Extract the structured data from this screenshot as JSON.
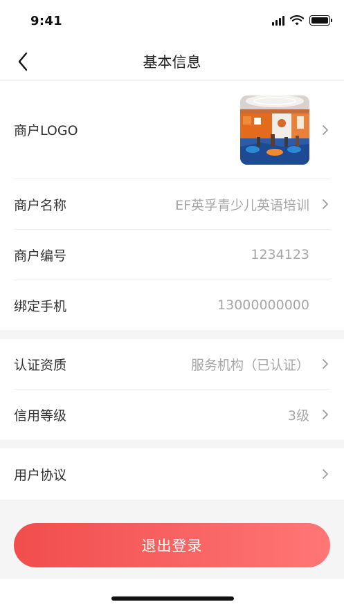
{
  "status_bar": {
    "time": "9:41",
    "icons": [
      "cellular-signal-icon",
      "wifi-icon",
      "battery-icon"
    ]
  },
  "nav": {
    "title": "基本信息",
    "back_icon": "chevron-left-icon"
  },
  "merchant": {
    "logo_label": "商户LOGO",
    "name_label": "商户名称",
    "name_value": "EF英孚青少儿英语培训",
    "id_label": "商户编号",
    "id_value": "1234123",
    "phone_label": "绑定手机",
    "phone_value": "13000000000"
  },
  "qualification": {
    "cert_label": "认证资质",
    "cert_value": "服务机构（已认证）",
    "credit_label": "信用等级",
    "credit_value": "3级"
  },
  "agreement": {
    "label": "用户协议"
  },
  "logout": {
    "label": "退出登录"
  },
  "colors": {
    "accent_start": "#f14d4d",
    "accent_end": "#ff7676",
    "value_text": "#a6a6a6",
    "background": "#f5f5f5"
  }
}
